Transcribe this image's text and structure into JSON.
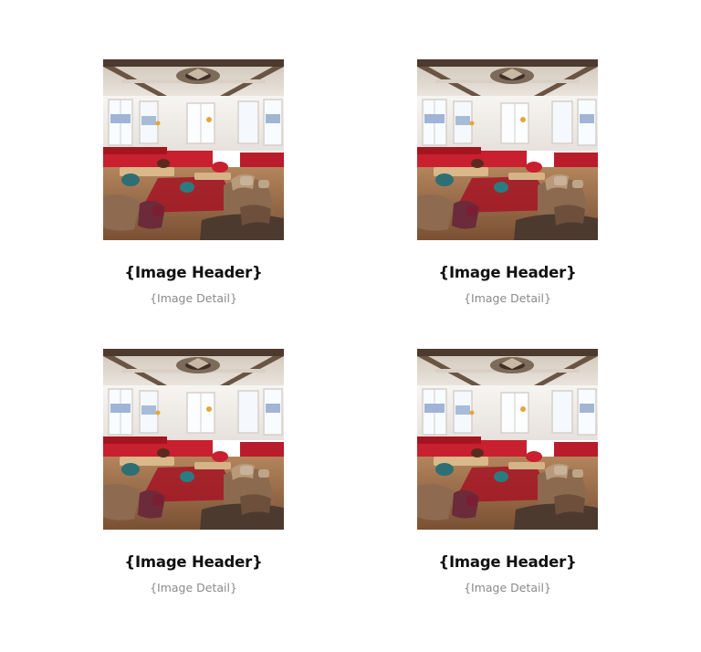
{
  "gallery": {
    "items": [
      {
        "header": "{Image Header}",
        "detail": "{Image Detail}",
        "image": "restaurant-interior-photo"
      },
      {
        "header": "{Image Header}",
        "detail": "{Image Detail}",
        "image": "restaurant-interior-photo"
      },
      {
        "header": "{Image Header}",
        "detail": "{Image Detail}",
        "image": "restaurant-interior-photo"
      },
      {
        "header": "{Image Header}",
        "detail": "{Image Detail}",
        "image": "restaurant-interior-photo"
      }
    ]
  },
  "colors": {
    "background": "#ffffff",
    "header_text": "#111111",
    "detail_text": "#8a8a8a",
    "photo_ceiling": "#e9e3dc",
    "photo_beams": "#5a4638",
    "photo_windows": "#f4f7fb",
    "photo_red_sofa": "#c8202e",
    "photo_floor": "#9b6a44",
    "photo_armchair": "#8a6a52"
  }
}
